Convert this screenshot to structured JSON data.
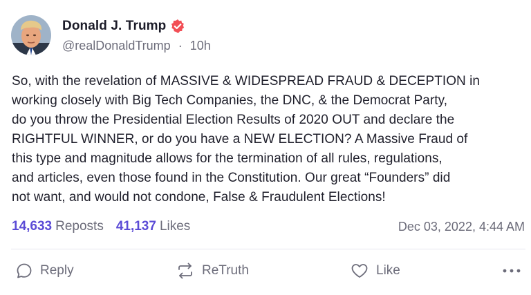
{
  "post": {
    "author": {
      "name": "Donald J. Trump",
      "handle": "@realDonaldTrump",
      "separator": "·",
      "time_ago": "10h"
    },
    "text_lines": [
      "So, with the revelation of MASSIVE & WIDESPREAD FRAUD & DECEPTION in",
      "working closely with Big Tech Companies, the DNC, & the Democrat Party,",
      "do you throw the Presidential Election Results of 2020 OUT and declare the",
      "RIGHTFUL WINNER, or do you have a NEW ELECTION? A Massive Fraud of",
      "this type and magnitude allows for the termination of all rules, regulations,",
      "and articles, even those found in the Constitution. Our great “Founders” did",
      "not want, and would not condone, False & Fraudulent Elections!"
    ],
    "stats": {
      "reposts_count": "14,633",
      "reposts_label": "Reposts",
      "likes_count": "41,137",
      "likes_label": "Likes",
      "timestamp": "Dec 03, 2022, 4:44 AM"
    },
    "actions": {
      "reply": "Reply",
      "retruth": "ReTruth",
      "like": "Like"
    }
  },
  "colors": {
    "accent": "#5b4bd6",
    "verified_badge": "#f24e55",
    "muted_text": "#6c6c7a",
    "body_text": "#1f1f2b"
  },
  "icons": [
    "avatar-portrait",
    "verified-badge-icon",
    "reply-icon",
    "retruth-icon",
    "like-icon",
    "more-icon"
  ]
}
